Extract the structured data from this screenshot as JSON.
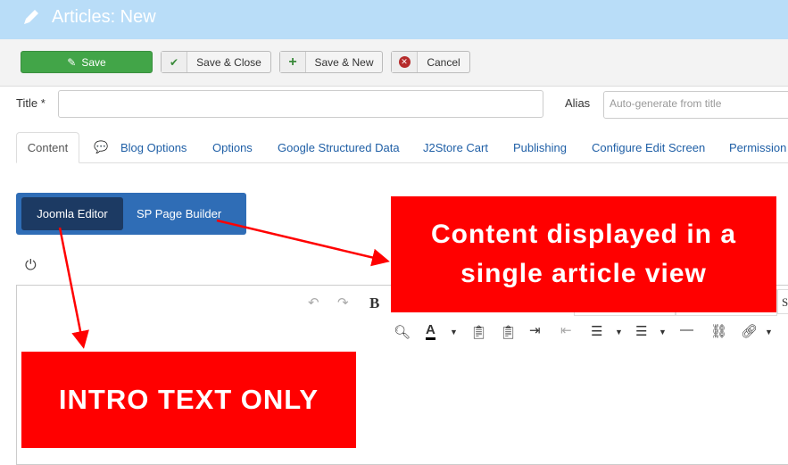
{
  "header": {
    "title": "Articles: New"
  },
  "toolbar": {
    "save": "Save",
    "save_close": "Save & Close",
    "save_new": "Save & New",
    "cancel": "Cancel"
  },
  "form": {
    "title_label": "Title *",
    "title_value": "",
    "alias_label": "Alias",
    "alias_placeholder": "Auto-generate from title"
  },
  "tabs": [
    "Content",
    "Blog Options",
    "Options",
    "Google Structured Data",
    "J2Store Cart",
    "Publishing",
    "Configure Edit Screen",
    "Permission"
  ],
  "editor_switch": {
    "joomla": "Joomla Editor",
    "sppb": "SP Page Builder"
  },
  "editor_toolbar": {
    "bold": "B",
    "select_partial": "S"
  },
  "annotations": {
    "box1_line1": "Content displayed in a",
    "box1_line2": "single article view",
    "box2": "INTRO TEXT ONLY"
  },
  "colors": {
    "header": "#b9ddf8",
    "save": "#42a548",
    "switch": "#2f6db6",
    "switch_active": "#1c3a63",
    "annotation": "#ff0000"
  }
}
